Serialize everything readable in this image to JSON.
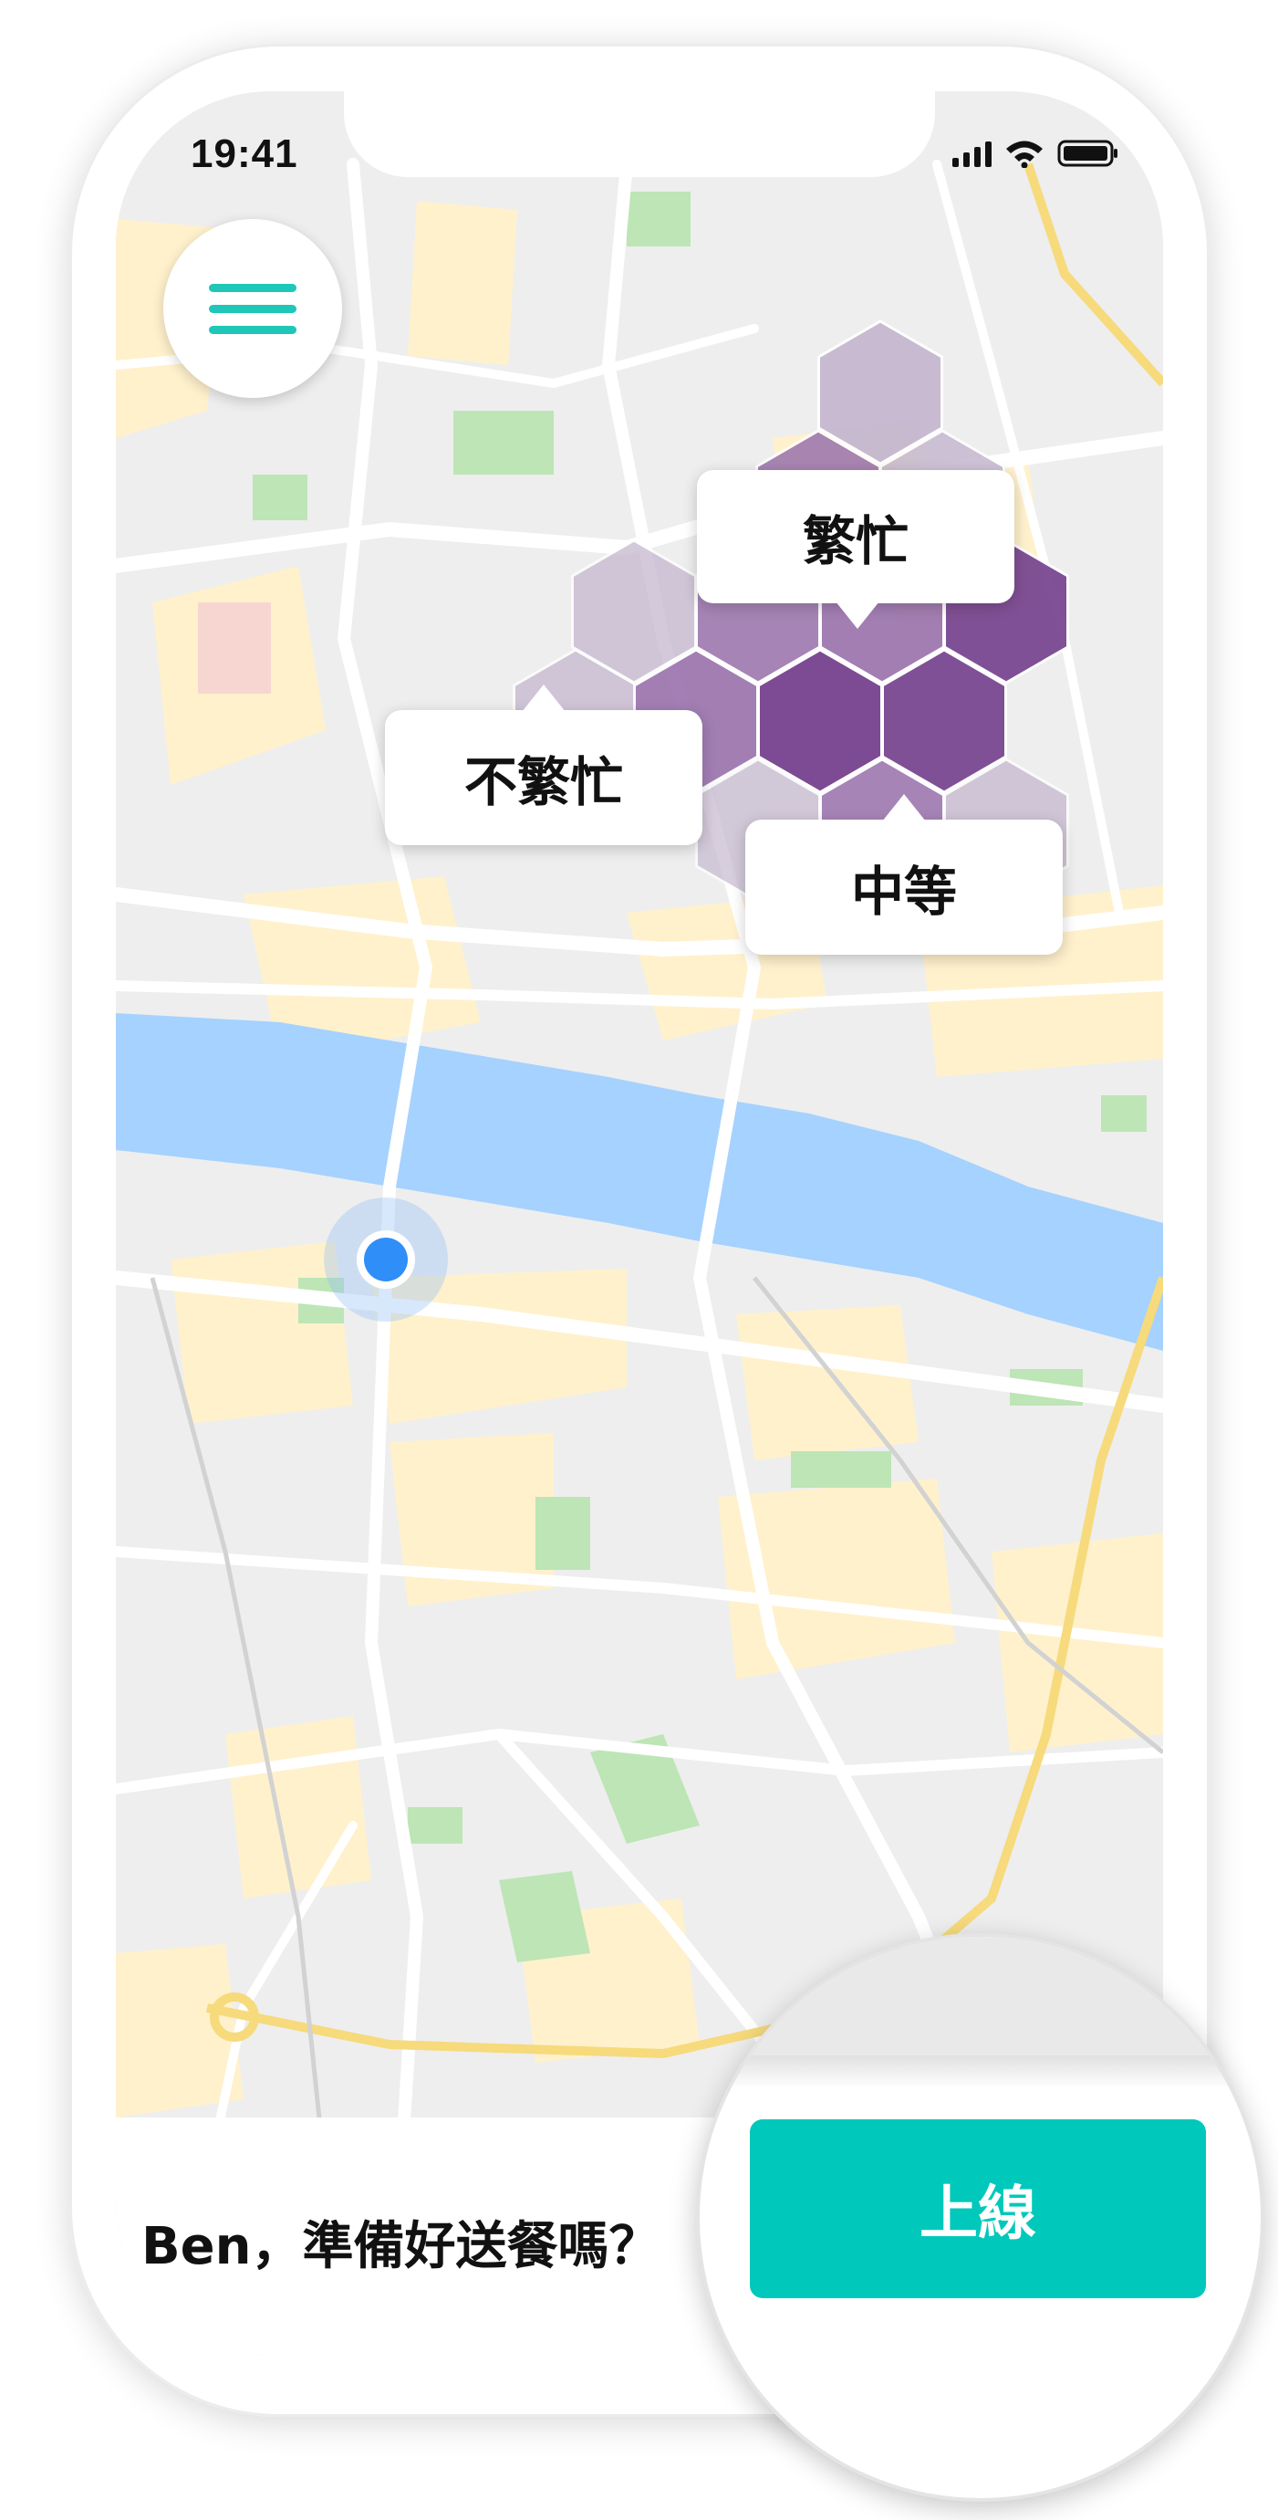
{
  "status_bar": {
    "time": "19:41"
  },
  "map": {
    "heatmap": {
      "colors": {
        "low": "#c5b8d0",
        "mid": "#9a72ad",
        "high": "#7a4892"
      }
    },
    "labels": {
      "busy": "繁忙",
      "not_busy": "不繁忙",
      "medium": "中等"
    },
    "colors": {
      "river": "#a5d2ff",
      "park": "#bde5b5",
      "area": "#fff1cc",
      "road": "#ffffff",
      "highway": "#f6da7c"
    }
  },
  "bottom_panel": {
    "prompt": "Ben，準備好送餐嗎？",
    "online_button": "上線"
  },
  "colors": {
    "accent": "#00c8bb",
    "menu_accent": "#1fc7b8",
    "location_dot": "#2f8ef7"
  },
  "icons": {
    "menu": "hamburger-menu-icon",
    "signal": "cellular-signal-icon",
    "wifi": "wifi-icon",
    "battery": "battery-icon"
  }
}
